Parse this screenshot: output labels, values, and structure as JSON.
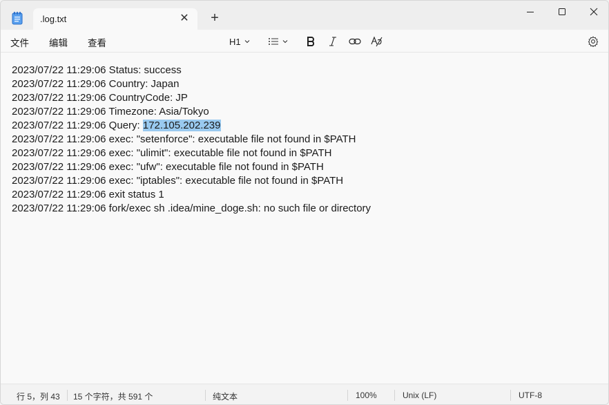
{
  "tab": {
    "title": ".log.txt",
    "close_glyph": "✕",
    "new_tab_glyph": "+"
  },
  "menu": {
    "file": "文件",
    "edit": "编辑",
    "view": "查看"
  },
  "toolbar": {
    "heading": "H1",
    "list_icon": "list-icon",
    "bold_icon": "bold-icon",
    "italic_icon": "italic-icon",
    "link_icon": "link-icon",
    "clear_format_icon": "clear-format-icon",
    "settings_icon": "gear-icon"
  },
  "document": {
    "lines": [
      "2023/07/22 11:29:06 Status: success",
      "2023/07/22 11:29:06 Country: Japan",
      "2023/07/22 11:29:06 CountryCode: JP",
      "2023/07/22 11:29:06 Timezone: Asia/Tokyo",
      "2023/07/22 11:29:06 Query: ",
      "2023/07/22 11:29:06 exec: \"setenforce\": executable file not found in $PATH",
      "2023/07/22 11:29:06 exec: \"ulimit\": executable file not found in $PATH",
      "2023/07/22 11:29:06 exec: \"ufw\": executable file not found in $PATH",
      "2023/07/22 11:29:06 exec: \"iptables\": executable file not found in $PATH",
      "2023/07/22 11:29:06 exit status 1",
      "2023/07/22 11:29:06 fork/exec sh .idea/mine_doge.sh: no such file or directory"
    ],
    "selected_text": "172.105.202.239"
  },
  "status": {
    "position": "行 5，列 43",
    "count": "15 个字符，共 591 个",
    "format": "纯文本",
    "zoom": "100%",
    "line_ending": "Unix (LF)",
    "encoding": "UTF-8"
  },
  "colors": {
    "selection": "#99c9ef",
    "notepad_icon": "#3b7fd6"
  }
}
